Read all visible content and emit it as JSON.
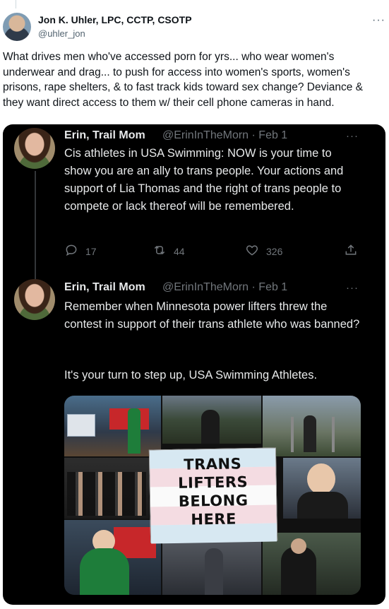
{
  "outer_post": {
    "author_name": "Jon K. Uhler, LPC, CCTP, CSOTP",
    "author_handle": "@uhler_jon",
    "more_label": "···",
    "text": "What drives men who've accessed porn for yrs... who wear women's underwear and drag... to push for access into women's sports, women's prisons, rape shelters, & to fast track kids toward sex change? Deviance & they want direct access to them w/ their cell phone cameras in hand."
  },
  "quoted_thread": [
    {
      "author_name": "Erin, Trail Mom",
      "author_handle": "@ErinInTheMorn",
      "date": "· Feb 1",
      "more_label": "···",
      "text": "Cis athletes in USA Swimming: NOW is your time to show you are an ally to trans people. Your actions and support of Lia Thomas and the right of trans people to compete or lack thereof will be remembered.",
      "replies": "17",
      "retweets": "44",
      "likes": "326"
    },
    {
      "author_name": "Erin, Trail Mom",
      "author_handle": "@ErinInTheMorn",
      "date": "· Feb 1",
      "more_label": "···",
      "text_line1": "Remember when Minnesota power lifters threw the contest in support of their trans athlete who was banned?",
      "text_line2": "It's your turn to step up, USA Swimming Athletes.",
      "flag_text": "TRANS\nLIFTERS\nBELONG\nHERE"
    }
  ],
  "icons": {
    "reply": "reply-icon",
    "retweet": "retweet-icon",
    "like": "heart-icon",
    "share": "share-icon"
  },
  "colors": {
    "outer_bg": "#ffffff",
    "quote_bg": "#000000",
    "secondary_text": "#71767b"
  }
}
